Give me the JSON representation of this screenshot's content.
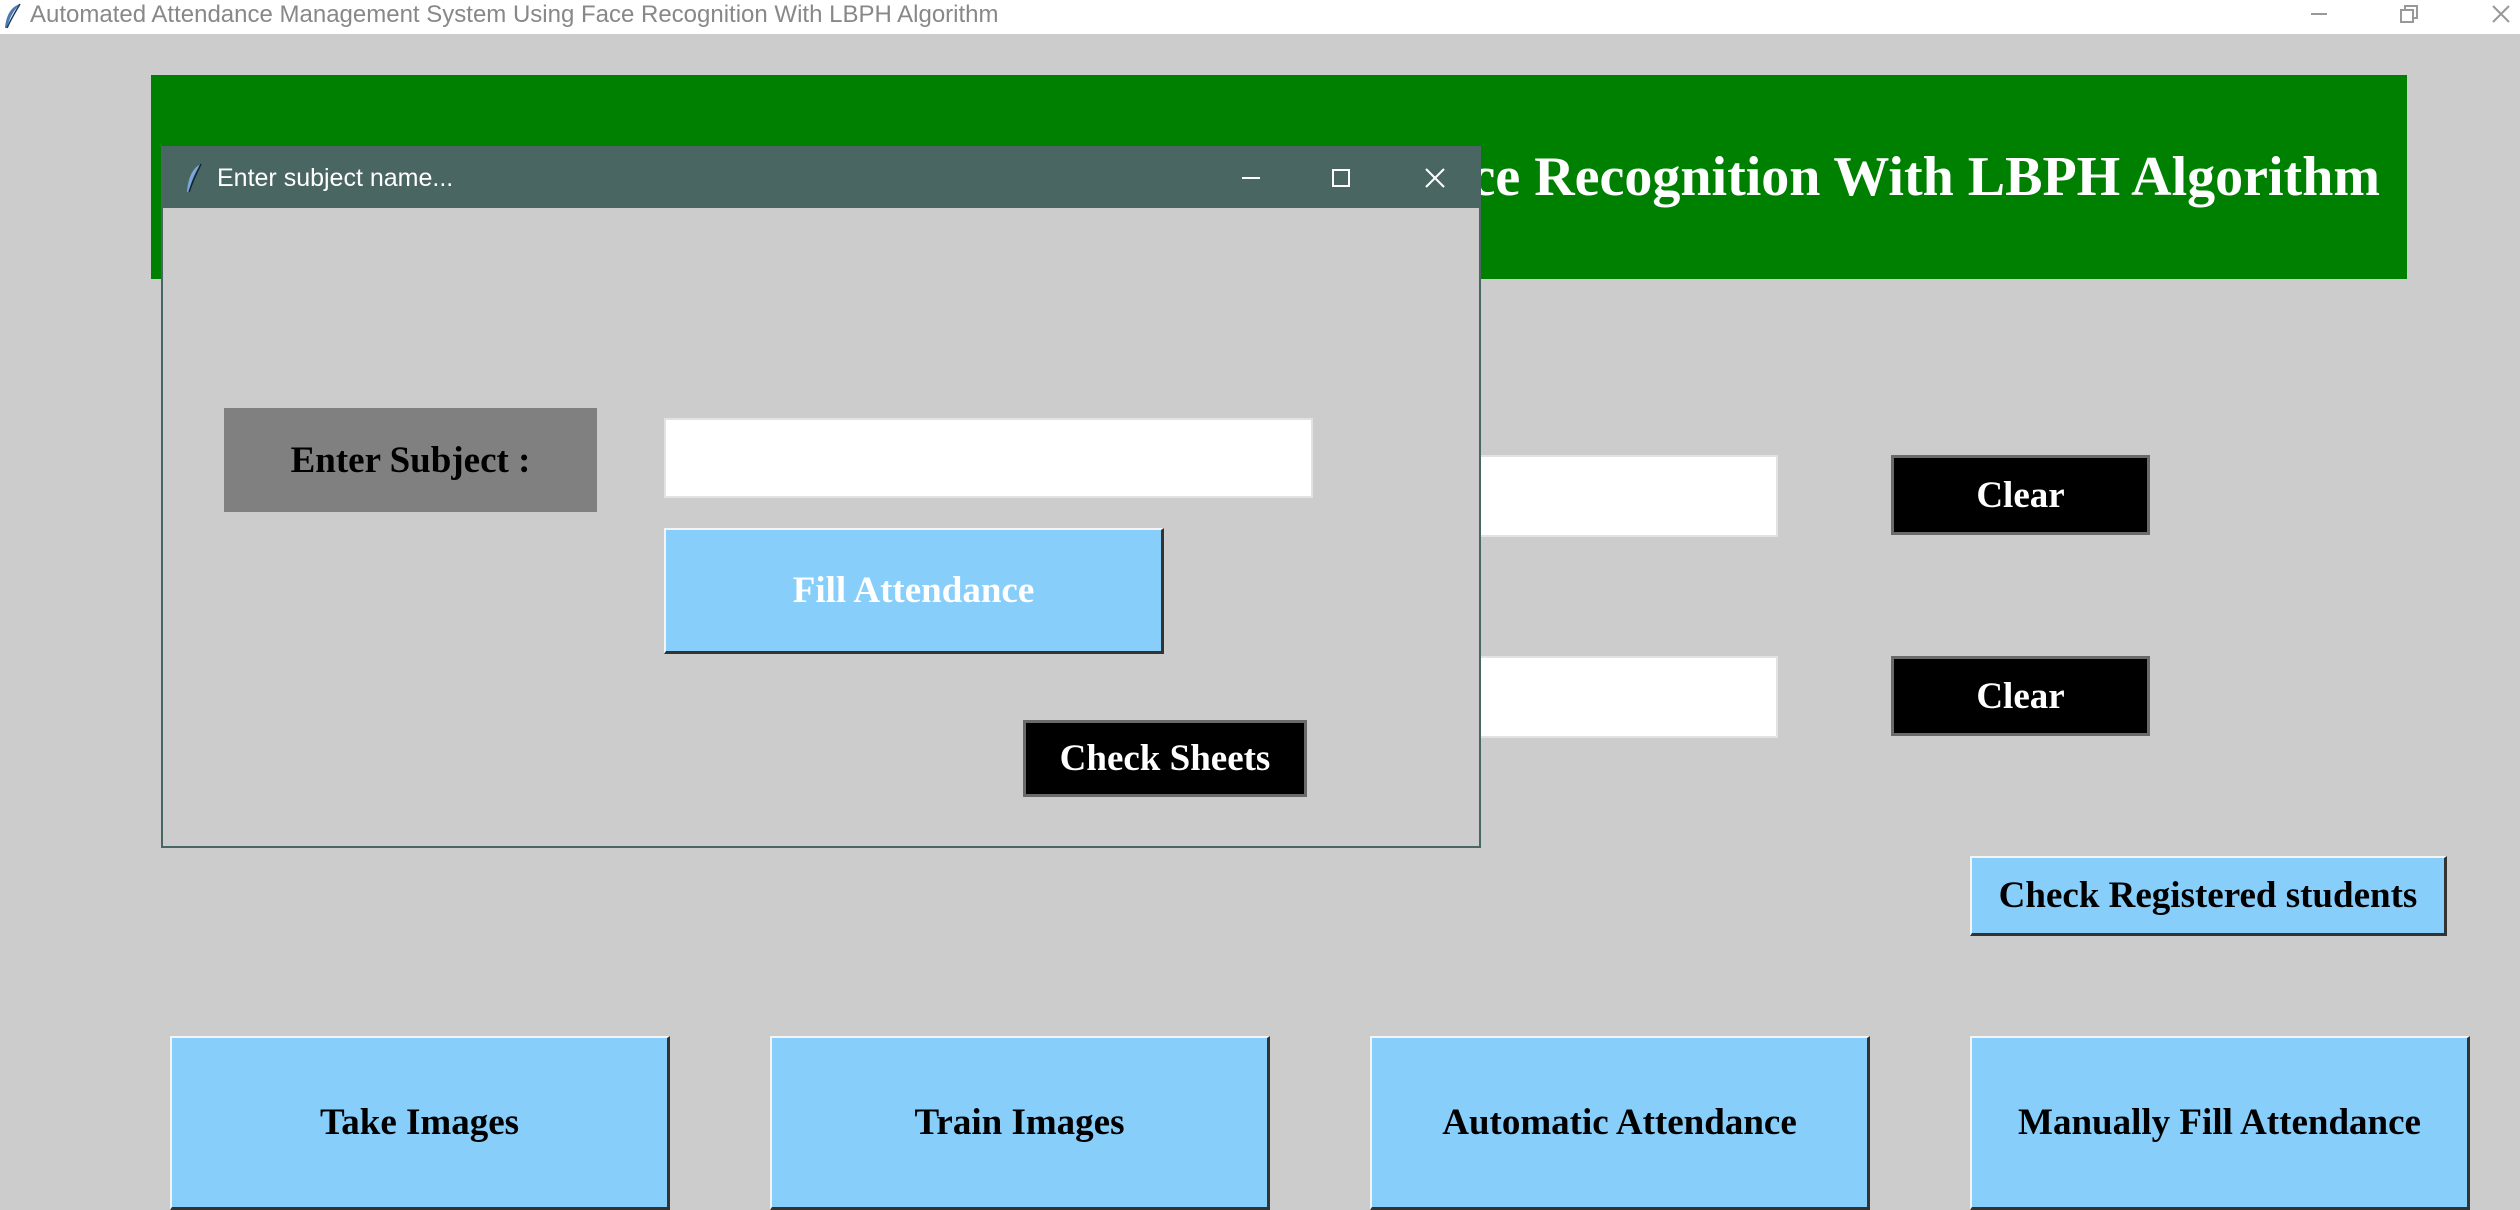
{
  "window": {
    "title": "Automated Attendance Management System Using Face Recognition With LBPH Algorithm",
    "icon": "feather-icon"
  },
  "header": {
    "text": "Automated Attendance Management System Using Face Recognition With LBPH Algorithm",
    "background": "#008000",
    "color": "#ffffff"
  },
  "main": {
    "enrollment_value": "",
    "name_value": "",
    "clear_label_1": "Clear",
    "clear_label_2": "Clear",
    "check_registered_label": "Check Registered students",
    "buttons": {
      "take_images": "Take Images",
      "train_images": "Train Images",
      "automatic_attendance": "Automatic Attendance",
      "manual_attendance": "Manually Fill Attendance"
    }
  },
  "dialog": {
    "title": "Enter subject name...",
    "subject_label": "Enter Subject :",
    "subject_value": "",
    "fill_label": "Fill Attendance",
    "check_sheets_label": "Check Sheets"
  },
  "colors": {
    "background": "#cccccc",
    "button_blue": "#87cefa",
    "dialog_titlebar": "#4a6663"
  }
}
